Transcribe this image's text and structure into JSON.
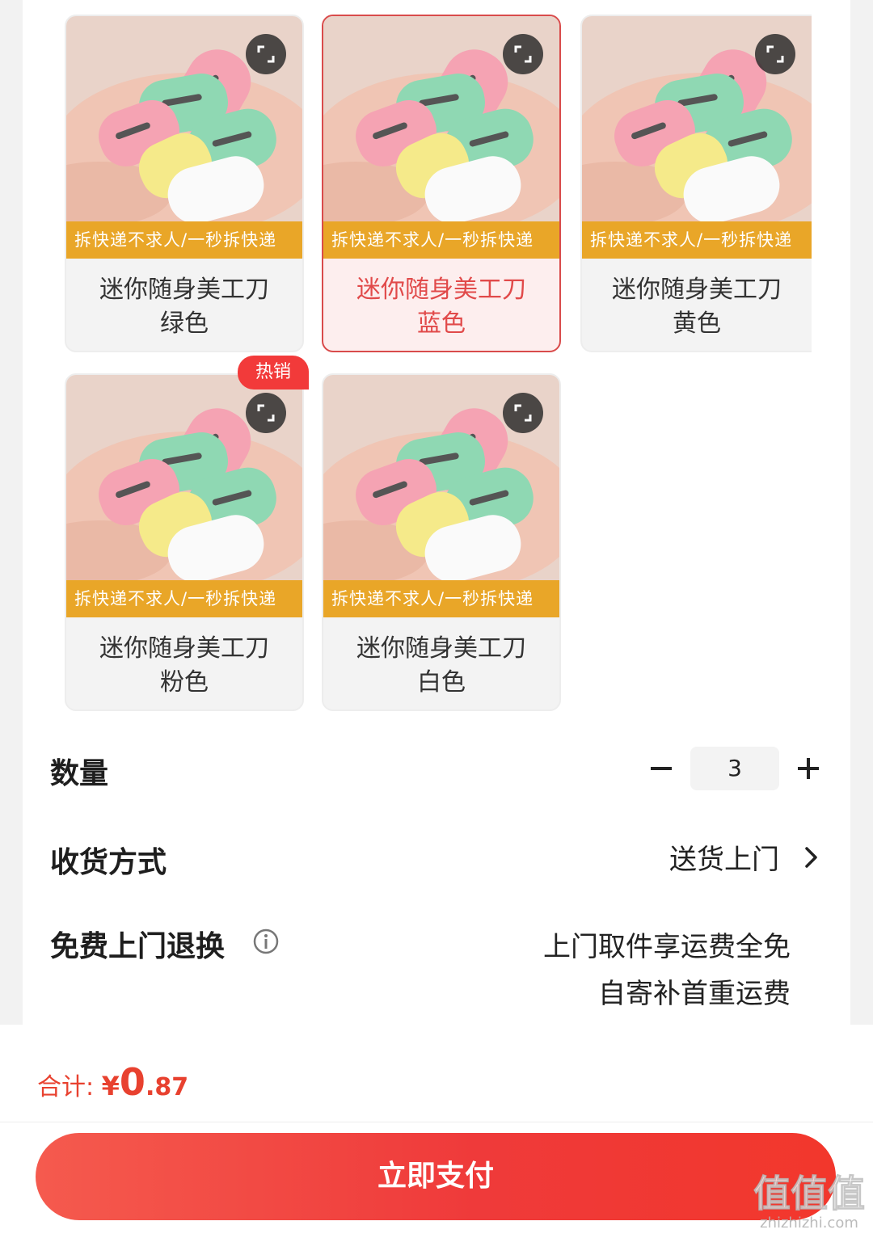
{
  "sku_options": [
    {
      "name": "迷你随身美工刀",
      "color": "绿色",
      "banner": "拆快递不求人/一秒拆快递",
      "selected": false,
      "hot": false
    },
    {
      "name": "迷你随身美工刀",
      "color": "蓝色",
      "banner": "拆快递不求人/一秒拆快递",
      "selected": true,
      "hot": false
    },
    {
      "name": "迷你随身美工刀",
      "color": "黄色",
      "banner": "拆快递不求人/一秒拆快递",
      "selected": false,
      "hot": false
    },
    {
      "name": "迷你随身美工刀",
      "color": "粉色",
      "banner": "拆快递不求人/一秒拆快递",
      "selected": false,
      "hot": true
    },
    {
      "name": "迷你随身美工刀",
      "color": "白色",
      "banner": "拆快递不求人/一秒拆快递",
      "selected": false,
      "hot": false
    }
  ],
  "hot_badge": "热销",
  "quantity": {
    "label": "数量",
    "value": "3",
    "minus_icon": "minus-icon",
    "plus_icon": "plus-icon"
  },
  "delivery": {
    "label": "收货方式",
    "value": "送货上门",
    "chevron_icon": "chevron-right-icon"
  },
  "returns": {
    "label": "免费上门退换",
    "info_icon": "info-icon",
    "line1": "上门取件享运费全免",
    "line2": "自寄补首重运费"
  },
  "footer": {
    "total_label": "合计:",
    "currency": "¥",
    "amount_int": "0",
    "amount_dec": ".87",
    "pay_button": "立即支付"
  },
  "watermark": {
    "logo": "值值值",
    "site": "zhizhizhi.com"
  },
  "colors": {
    "accent": "#f23a3a",
    "banner": "#e9a628",
    "selected_text": "#e14a4a"
  }
}
